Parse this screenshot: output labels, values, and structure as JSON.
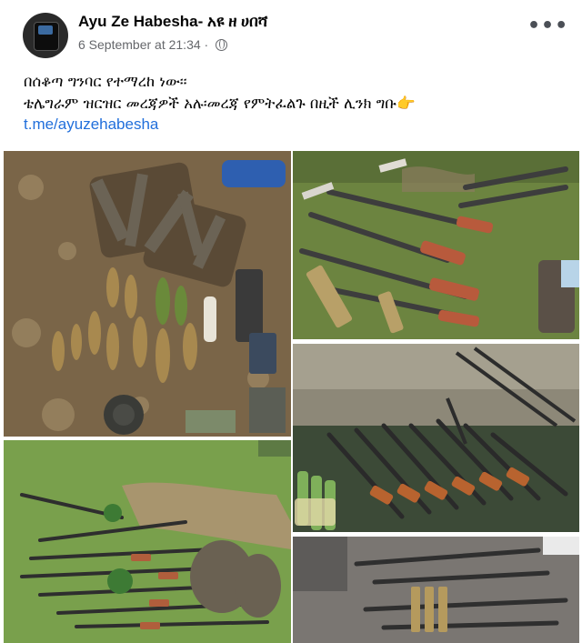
{
  "post": {
    "author": "Ayu Ze Habesha- አዩ ዘ ሀበሻ",
    "timestamp": "6 September at 21:34",
    "visibility_icon": "globe-icon",
    "more_icon": "more-options-icon",
    "more_label": "•••",
    "text_lines": [
      "በሰቆጣ ግንባር የተማረከ ነው፡፡",
      "ቴሌግራም ዝርዝር መረጃዎች አሉ፡መረጃ የምትፈልጉ በዚች ሊንክ ግቡ👉"
    ],
    "link": "t.me/ayuzehabesha"
  },
  "photos": [
    {
      "icon": "photo-captured-ammunition"
    },
    {
      "icon": "photo-captured-machine-guns"
    },
    {
      "icon": "photo-captured-rifles"
    },
    {
      "icon": "photo-weapons-on-grass"
    },
    {
      "icon": "photo-heavy-machine-guns"
    }
  ],
  "colors": {
    "author_text": "#050505",
    "meta_text": "#65676b",
    "link_text": "#216fdb",
    "background": "#ffffff"
  }
}
